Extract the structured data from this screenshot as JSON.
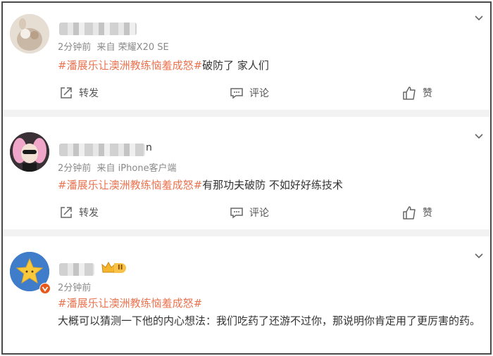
{
  "hashtag": "#潘展乐让澳洲教练恼羞成怒#",
  "actions": {
    "repost": "转发",
    "comment": "评论",
    "like": "赞"
  },
  "posts": [
    {
      "time": "2分钟前",
      "source": "来自 荣耀X20 SE",
      "tag": "#潘展乐让澳洲教练恼羞成怒#",
      "text": "破防了 家人们"
    },
    {
      "time": "2分钟前",
      "source": "来自 iPhone客户端",
      "tag": "#潘展乐让澳洲教练恼羞成怒#",
      "text": "有那功夫破防 不如好好练技术",
      "name_tail": "n"
    },
    {
      "time": "2分钟前",
      "tag": "#潘展乐让澳洲教练恼羞成怒#",
      "text": "大概可以猜测一下他的内心想法：我们吃药了还游不过你，那说明你肯定用了更厉害的药。",
      "badge": "II"
    }
  ],
  "colors": {
    "hashtag": "#eb7350",
    "meta": "#8a8a8a",
    "separator": "#f2f2f2",
    "verified": "#e8591c"
  }
}
